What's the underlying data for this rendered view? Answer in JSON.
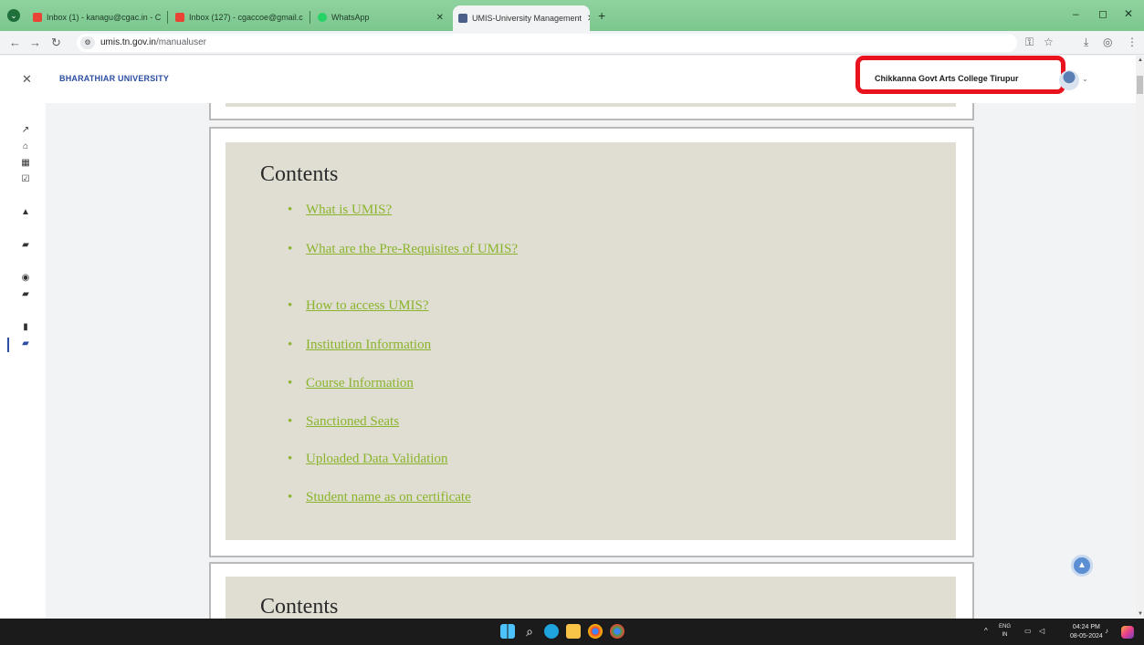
{
  "browser": {
    "tabs": [
      {
        "title": "Inbox (1) - kanagu@cgac.in - C",
        "active": false
      },
      {
        "title": "Inbox (127) - cgaccoe@gmail.c",
        "active": false
      },
      {
        "title": "WhatsApp",
        "active": false
      },
      {
        "title": "UMIS-University Management",
        "active": true
      }
    ],
    "new_tab_label": "+",
    "url_host": "umis.tn.gov.in",
    "url_path": "/manualuser",
    "window_controls": [
      "–",
      "◻",
      "✕"
    ]
  },
  "app": {
    "close_label": "✕",
    "brand": "BHARATHIAR UNIVERSITY",
    "college_name": "Chikkanna Govt Arts College Tirupur",
    "avatar_caret": "⌄",
    "highlight_color": "#e8131f"
  },
  "sidebar": {
    "items": [
      {
        "icon": "chart-line-icon",
        "glyph": "📈"
      },
      {
        "icon": "institution-icon",
        "glyph": "🏛"
      },
      {
        "icon": "table-icon",
        "glyph": "▦"
      },
      {
        "icon": "checkbox-icon",
        "glyph": "☑"
      },
      {
        "icon": "graduation-cap-icon",
        "glyph": "🎓"
      },
      {
        "icon": "book-icon",
        "glyph": "▰"
      },
      {
        "icon": "user-circle-icon",
        "glyph": "◉"
      },
      {
        "icon": "book-icon",
        "glyph": "▰"
      },
      {
        "icon": "file-icon",
        "glyph": "▮"
      },
      {
        "icon": "book-icon",
        "glyph": "▰"
      }
    ]
  },
  "manual": {
    "contents_heading": "Contents",
    "toc": [
      "What is UMIS?",
      "What are the Pre-Requisites of UMIS?",
      "How to access UMIS?",
      "Institution Information",
      "Course Information",
      "Sanctioned Seats",
      "Uploaded Data Validation",
      "Student name as on certificate"
    ],
    "contents_heading_2": "Contents",
    "link_color": "#8ab42c",
    "panel_color": "#e0ddd2"
  },
  "taskbar": {
    "language": "ENG",
    "region": "IN",
    "time": "04:24 PM",
    "date": "08-05-2024"
  }
}
